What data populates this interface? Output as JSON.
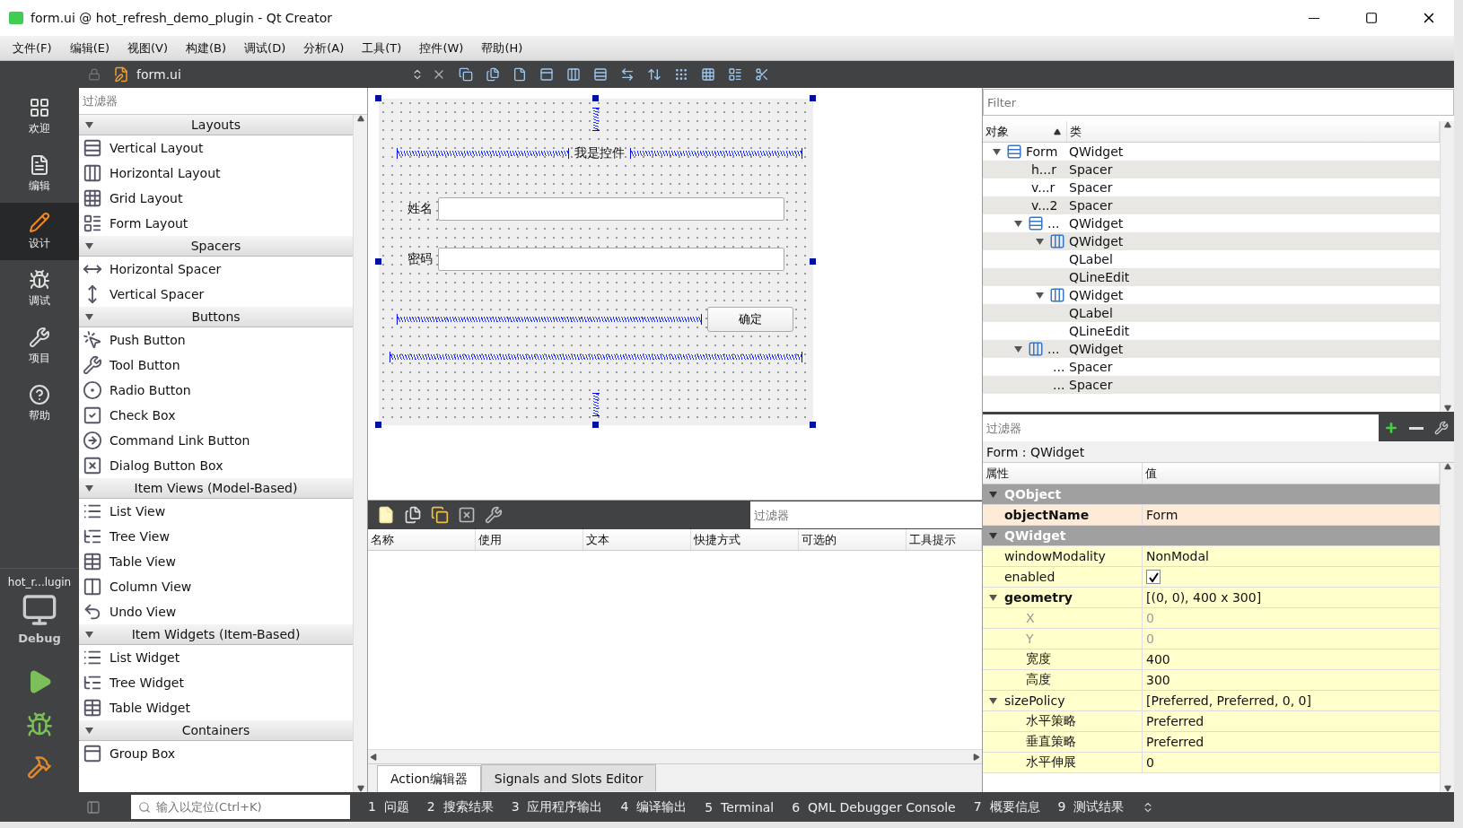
{
  "window": {
    "title": "form.ui @ hot_refresh_demo_plugin - Qt Creator"
  },
  "menu": [
    "文件(F)",
    "编辑(E)",
    "视图(V)",
    "构建(B)",
    "调试(D)",
    "分析(A)",
    "工具(T)",
    "控件(W)",
    "帮助(H)"
  ],
  "editor_toolbar": {
    "file": "form.ui"
  },
  "modes": [
    {
      "label": "欢迎",
      "selected": false
    },
    {
      "label": "编辑",
      "selected": false
    },
    {
      "label": "设计",
      "selected": true
    },
    {
      "label": "调试",
      "selected": false
    },
    {
      "label": "项目",
      "selected": false
    },
    {
      "label": "帮助",
      "selected": false
    }
  ],
  "kit": {
    "project": "hot_r...lugin",
    "config": "Debug"
  },
  "widget_box": {
    "placeholder": "过滤器",
    "categories": [
      {
        "name": "Layouts",
        "expanded": true,
        "items": [
          "Vertical Layout",
          "Horizontal Layout",
          "Grid Layout",
          "Form Layout"
        ]
      },
      {
        "name": "Spacers",
        "expanded": true,
        "items": [
          "Horizontal Spacer",
          "Vertical Spacer"
        ]
      },
      {
        "name": "Buttons",
        "expanded": true,
        "items": [
          "Push Button",
          "Tool Button",
          "Radio Button",
          "Check Box",
          "Command Link Button",
          "Dialog Button Box"
        ]
      },
      {
        "name": "Item Views (Model-Based)",
        "expanded": true,
        "items": [
          "List View",
          "Tree View",
          "Table View",
          "Column View",
          "Undo View"
        ]
      },
      {
        "name": "Item Widgets (Item-Based)",
        "expanded": true,
        "items": [
          "List Widget",
          "Tree Widget",
          "Table Widget"
        ]
      },
      {
        "name": "Containers",
        "expanded": true,
        "items": [
          "Group Box"
        ]
      }
    ]
  },
  "form": {
    "heading": "我是控件",
    "fields": [
      {
        "label": "姓名"
      },
      {
        "label": "密码"
      }
    ],
    "button": "确定"
  },
  "action_editor": {
    "placeholder": "过滤器",
    "columns": [
      "名称",
      "使用",
      "文本",
      "快捷方式",
      "可选的",
      "工具提示"
    ],
    "tabs": [
      {
        "label": "Action编辑器",
        "selected": true
      },
      {
        "label": "Signals and Slots Editor",
        "selected": false
      }
    ]
  },
  "object_inspector": {
    "placeholder": "Filter",
    "columns": [
      "对象",
      "类"
    ],
    "tree": [
      {
        "object": "Form",
        "class": "QWidget",
        "kind": "vbox",
        "expanded": true,
        "children": [
          {
            "object": "h...r",
            "class": "Spacer"
          },
          {
            "object": "v...r",
            "class": "Spacer"
          },
          {
            "object": "v...2",
            "class": "Spacer"
          },
          {
            "object": "...",
            "class": "QWidget",
            "kind": "vbox",
            "expanded": true,
            "children": [
              {
                "class": "QWidget",
                "kind": "hbox",
                "expanded": true,
                "children": [
                  {
                    "class": "QLabel"
                  },
                  {
                    "class": "QLineEdit"
                  }
                ]
              },
              {
                "class": "QWidget",
                "kind": "hbox",
                "expanded": true,
                "children": [
                  {
                    "class": "QLabel"
                  },
                  {
                    "class": "QLineEdit"
                  }
                ]
              }
            ]
          },
          {
            "object": "...",
            "class": "QWidget",
            "kind": "hbox",
            "expanded": true,
            "children": [
              {
                "object": "...",
                "class": "Spacer"
              },
              {
                "object": "...",
                "class": "Spacer"
              }
            ]
          }
        ]
      }
    ]
  },
  "property_editor": {
    "placeholder": "过滤器",
    "selection": "Form : QWidget",
    "columns": [
      "属性",
      "值"
    ],
    "groups": [
      {
        "name": "QObject",
        "expanded": true,
        "color": "#fdebd8",
        "properties": [
          {
            "name": "objectName",
            "value": "Form",
            "bold": true,
            "disabled": false
          }
        ]
      },
      {
        "name": "QWidget",
        "expanded": true,
        "color": "#ffffcc",
        "properties": [
          {
            "name": "windowModality",
            "value": "NonModal",
            "bold": false,
            "disabled": false
          },
          {
            "name": "enabled",
            "kind": "checkbox",
            "checked": true,
            "bold": false,
            "disabled": false
          },
          {
            "name": "geometry",
            "value": "[(0, 0), 400 x 300]",
            "bold": true,
            "disabled": false,
            "expanded": true,
            "children": [
              {
                "name": "X",
                "value": "0",
                "bold": false,
                "disabled": true
              },
              {
                "name": "Y",
                "value": "0",
                "bold": false,
                "disabled": true
              },
              {
                "name": "宽度",
                "value": "400",
                "bold": false,
                "disabled": false
              },
              {
                "name": "高度",
                "value": "300",
                "bold": false,
                "disabled": false
              }
            ]
          },
          {
            "name": "sizePolicy",
            "value": "[Preferred, Preferred, 0, 0]",
            "bold": false,
            "disabled": false,
            "expanded": true,
            "children": [
              {
                "name": "水平策略",
                "value": "Preferred",
                "bold": false,
                "disabled": false
              },
              {
                "name": "垂直策略",
                "value": "Preferred",
                "bold": false,
                "disabled": false
              },
              {
                "name": "水平伸展",
                "value": "0",
                "bold": false,
                "disabled": false
              }
            ]
          }
        ]
      }
    ]
  },
  "status_bar": {
    "placeholder": "输入以定位(Ctrl+K)",
    "panes": [
      {
        "number": "1",
        "label": "问题"
      },
      {
        "number": "2",
        "label": "搜索结果"
      },
      {
        "number": "3",
        "label": "应用程序输出"
      },
      {
        "number": "4",
        "label": "编译输出"
      },
      {
        "number": "5",
        "label": "Terminal"
      },
      {
        "number": "6",
        "label": "QML Debugger Console"
      },
      {
        "number": "7",
        "label": "概要信息"
      },
      {
        "number": "9",
        "label": "测试结果"
      }
    ]
  }
}
